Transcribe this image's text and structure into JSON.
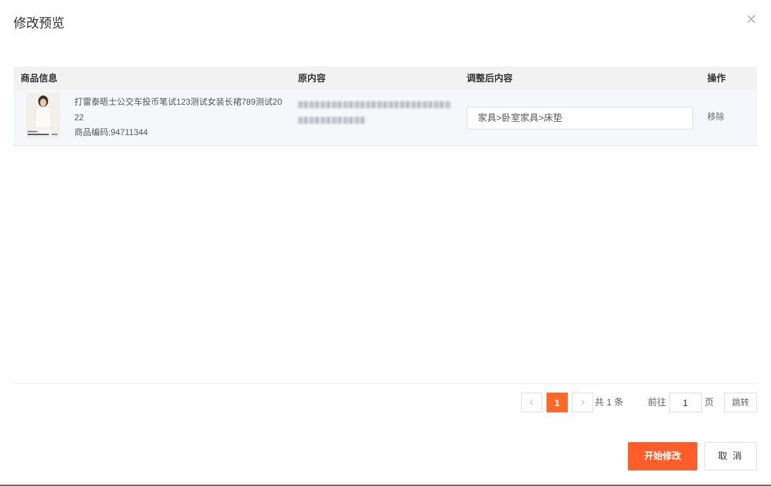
{
  "dialog": {
    "title": "修改预览",
    "close_icon": "close-icon"
  },
  "table": {
    "columns": [
      "商品信息",
      "原内容",
      "调整后内容",
      "操作"
    ],
    "rows": [
      {
        "product_name": "打雷泰晤士公交车投币笔试123测试女装长裙789测试2022",
        "product_code": "商品编码:94711344",
        "original_content": "",
        "new_content": "家具>卧室家具>床垫",
        "action": "移除"
      }
    ]
  },
  "pagination": {
    "prev_icon": "chevron-left-icon",
    "next_icon": "chevron-right-icon",
    "current_page": "1",
    "total": "共 1 条",
    "goto_label": "前往",
    "goto_value": "1",
    "page_unit": "页",
    "jump_label": "跳转"
  },
  "footer": {
    "start_label": "开始修改",
    "cancel_label": "取 消"
  },
  "colors": {
    "accent": "#ff5e2b",
    "header_bg": "#f2f2f2",
    "row_bg": "#f5f7fb"
  }
}
